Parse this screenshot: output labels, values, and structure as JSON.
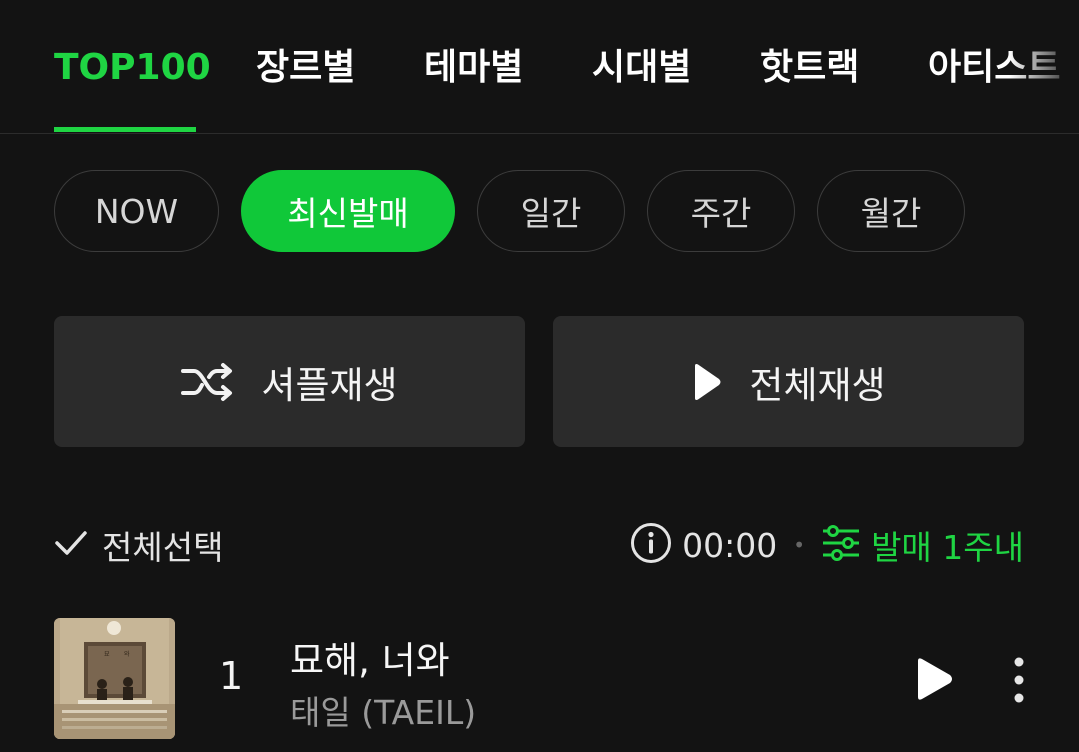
{
  "tabs": [
    {
      "label": "TOP100",
      "active": true
    },
    {
      "label": "장르별",
      "active": false
    },
    {
      "label": "테마별",
      "active": false
    },
    {
      "label": "시대별",
      "active": false
    },
    {
      "label": "핫트랙",
      "active": false
    },
    {
      "label": "아티스트",
      "active": false
    }
  ],
  "chips": [
    {
      "label": "NOW",
      "active": false
    },
    {
      "label": "최신발매",
      "active": true
    },
    {
      "label": "일간",
      "active": false
    },
    {
      "label": "주간",
      "active": false
    },
    {
      "label": "월간",
      "active": false
    }
  ],
  "actions": {
    "shuffle_label": "셔플재생",
    "play_all_label": "전체재생"
  },
  "selection": {
    "select_all_label": "전체선택",
    "total_time": "00:00",
    "filter_label": "발매 1주내"
  },
  "tracks": [
    {
      "rank": "1",
      "title": "묘해, 너와",
      "artist": "태일 (TAEIL)"
    }
  ],
  "colors": {
    "accent": "#1fd543",
    "chip_active": "#10c839",
    "background": "#131313",
    "button_bg": "#2b2b2b"
  },
  "icons": {
    "shuffle": "shuffle-icon",
    "play": "play-icon",
    "check": "check-icon",
    "info": "info-icon",
    "filter": "sliders-icon",
    "more": "more-vertical-icon"
  }
}
